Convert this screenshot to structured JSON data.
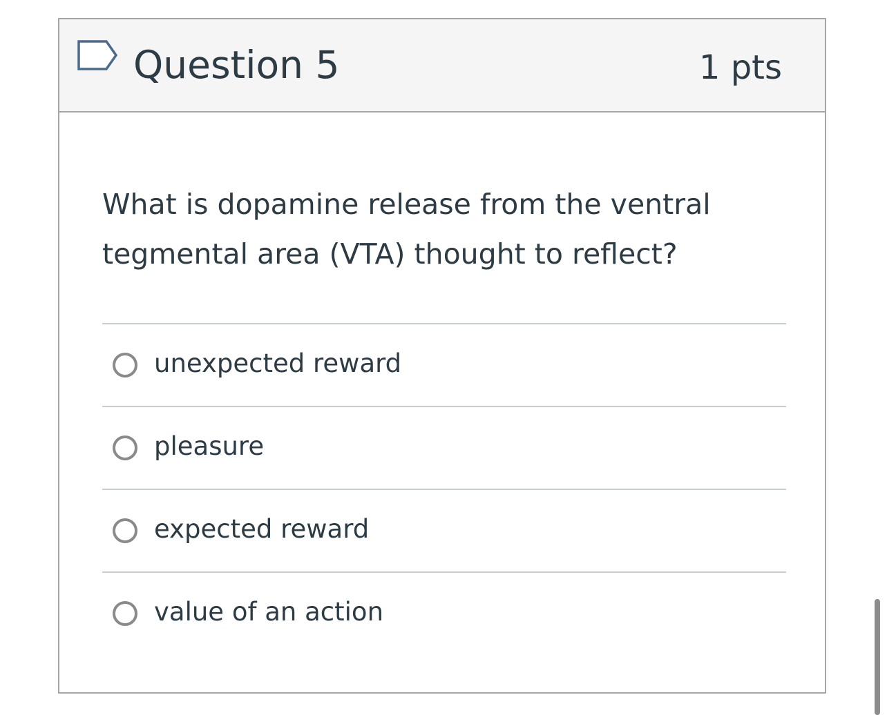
{
  "question": {
    "title": "Question 5",
    "points": "1 pts",
    "flag_icon": "flag-outline-icon",
    "text": "What is dopamine release from the ventral tegmental area (VTA) thought to reflect?",
    "answers": [
      {
        "label": "unexpected reward",
        "selected": false
      },
      {
        "label": "pleasure",
        "selected": false
      },
      {
        "label": "expected reward",
        "selected": false
      },
      {
        "label": "value of an action",
        "selected": false
      }
    ]
  },
  "colors": {
    "text": "#2d3b45",
    "header_bg": "#f5f5f5",
    "border": "#a6a6a6",
    "divider": "#c7cdd1",
    "flag": "#4b6a8a",
    "radio": "#8a8a8a"
  }
}
